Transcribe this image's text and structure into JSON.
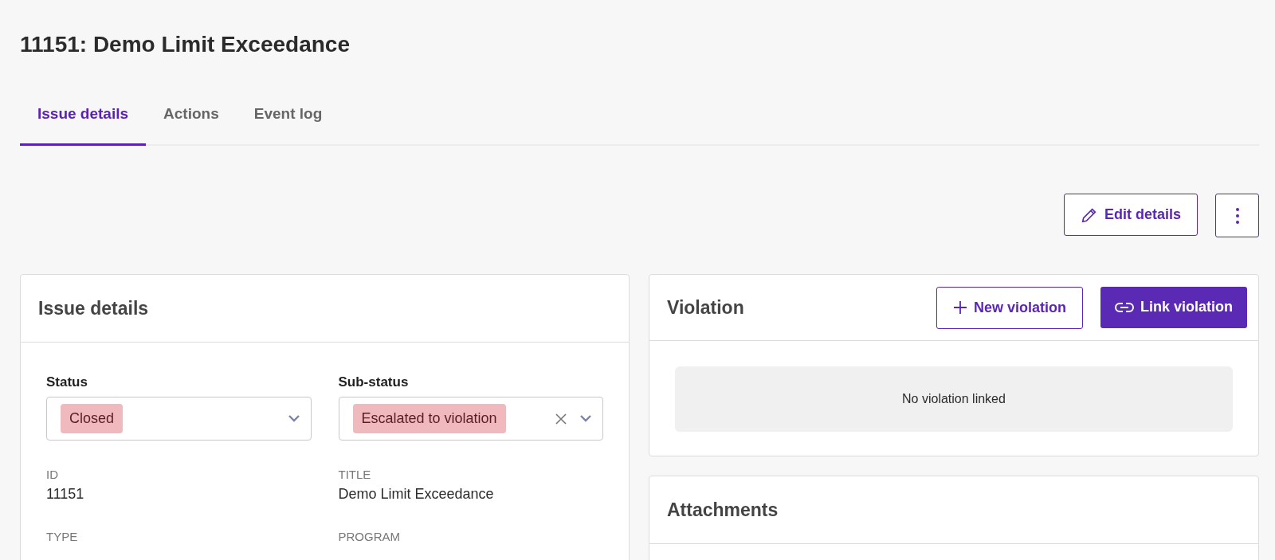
{
  "page_title": "11151: Demo Limit Exceedance",
  "tabs": [
    {
      "label": "Issue details",
      "selected": true
    },
    {
      "label": "Actions",
      "selected": false
    },
    {
      "label": "Event log",
      "selected": false
    }
  ],
  "toolbar": {
    "edit_button": "Edit details"
  },
  "issue_card": {
    "title": "Issue details",
    "selects": [
      {
        "label": "Status",
        "value": "Closed",
        "clearable": false
      },
      {
        "label": "Sub-status",
        "value": "Escalated to violation",
        "clearable": true
      }
    ],
    "fields": [
      {
        "label": "ID",
        "value": "11151"
      },
      {
        "label": "TITLE",
        "value": "Demo Limit Exceedance"
      },
      {
        "label": "TYPE"
      },
      {
        "label": "PROGRAM"
      }
    ]
  },
  "violation_card": {
    "title": "Violation",
    "new_button": "New violation",
    "link_button": "Link violation",
    "empty_text": "No violation linked"
  },
  "attachments_card": {
    "title": "Attachments"
  }
}
